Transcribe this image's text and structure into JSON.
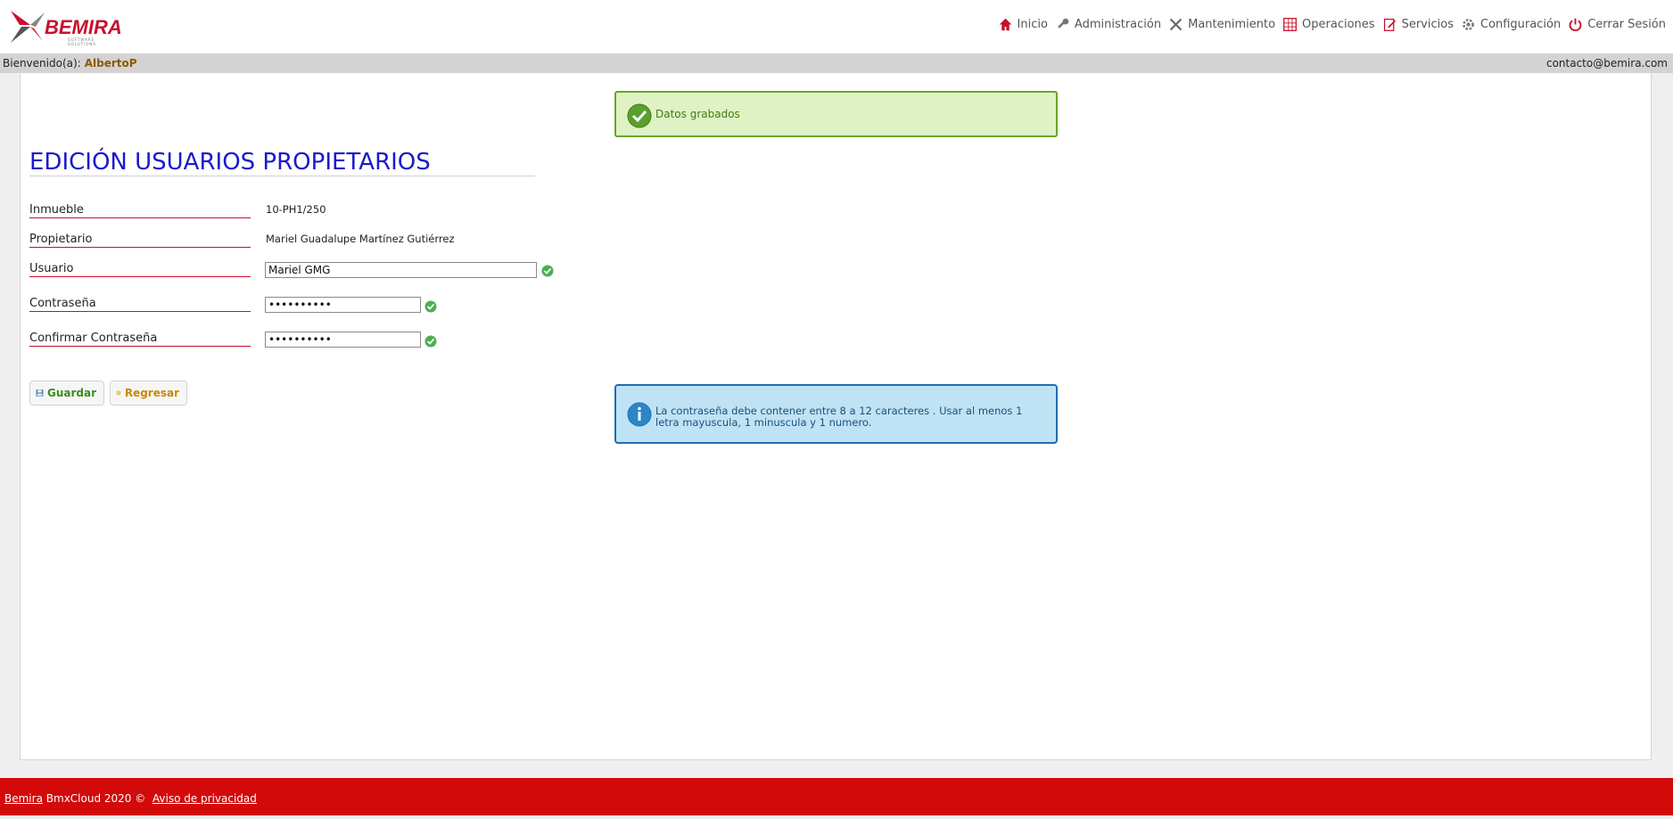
{
  "brand": {
    "name": "BEMIRA",
    "tagline": "SOFTWARE SOLUTIONS"
  },
  "nav": [
    {
      "label": "Inicio",
      "icon": "home-icon"
    },
    {
      "label": "Administración",
      "icon": "key-icon"
    },
    {
      "label": "Mantenimiento",
      "icon": "tools-icon"
    },
    {
      "label": "Operaciones",
      "icon": "grid-icon"
    },
    {
      "label": "Servicios",
      "icon": "edit-icon"
    },
    {
      "label": "Configuración",
      "icon": "gear-icon"
    },
    {
      "label": "Cerrar Sesión",
      "icon": "power-icon"
    }
  ],
  "welcome": {
    "label": "Bienvenido(a):",
    "user": "AlbertoP",
    "email": "contacto@bemira.com"
  },
  "alerts": {
    "success": "Datos grabados",
    "info": "La contraseña debe contener entre 8 a 12 caracteres . Usar al menos 1 letra mayuscula, 1 minuscula y 1 numero."
  },
  "form": {
    "title": "EDICIÓN USUARIOS PROPIETARIOS",
    "inmueble_label": "Inmueble",
    "inmueble_value": "10-PH1/250",
    "propietario_label": "Propietario",
    "propietario_value": "Mariel Guadalupe Martínez Gutiérrez",
    "usuario_label": "Usuario",
    "usuario_value": "Mariel GMG",
    "password_label": "Contraseña",
    "password_value": "••••••••••",
    "confirm_label": "Confirmar Contraseña",
    "confirm_value": "••••••••••"
  },
  "buttons": {
    "save": "Guardar",
    "back": "Regresar"
  },
  "footer": {
    "brand_link": "Bemira",
    "text": "BmxCloud 2020 ©",
    "privacy_link": "Aviso de privacidad"
  },
  "colors": {
    "accent_red": "#d20a0a",
    "title_blue": "#1a1acc",
    "success_green": "#6ca32b",
    "info_blue": "#1f6eb0"
  }
}
